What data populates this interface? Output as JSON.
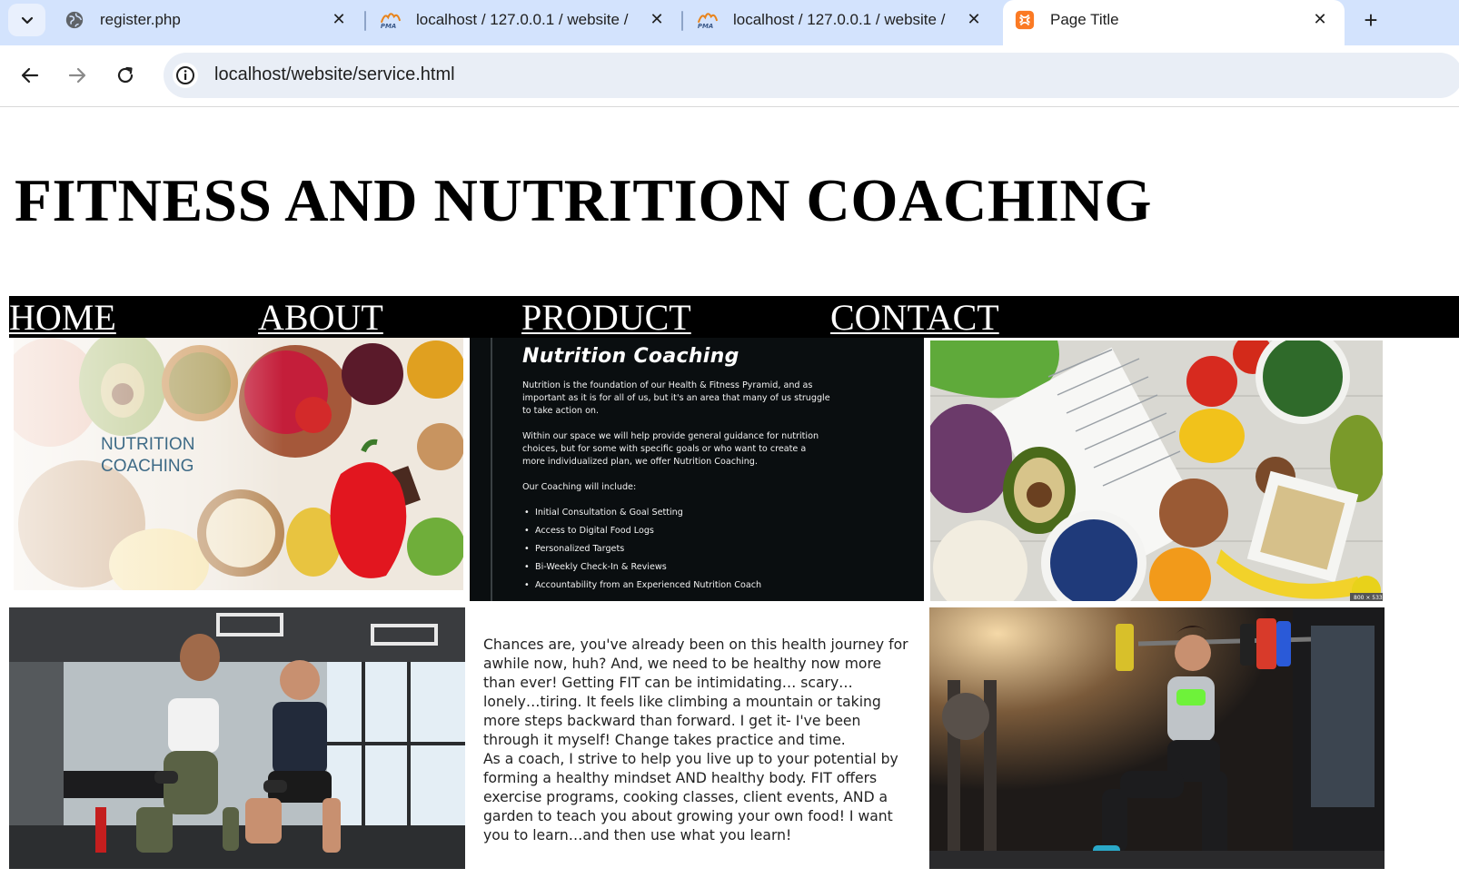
{
  "browser": {
    "tabs": [
      {
        "title": "register.php",
        "favicon": "globe-icon"
      },
      {
        "title": "localhost / 127.0.0.1 / website /",
        "favicon": "phpmyadmin-icon"
      },
      {
        "title": "localhost / 127.0.0.1 / website /",
        "favicon": "phpmyadmin-icon"
      },
      {
        "title": "Page Title",
        "favicon": "xampp-icon",
        "active": true
      }
    ],
    "url": "localhost/website/service.html",
    "colors": {
      "tabstrip": "#d3e3fd",
      "omnibox": "#e9eef6"
    }
  },
  "page": {
    "title": "FITNESS AND NUTRITION COACHING",
    "nav": [
      "HOME",
      "ABOUT",
      "PRODUCT",
      "CONTACT"
    ],
    "colors": {
      "navbar": "#000000",
      "nav_text": "#ffffff"
    },
    "gallery": {
      "nutrition_banner_text": [
        "NUTRITION",
        "COACHING"
      ],
      "info_card": {
        "heading": "Nutrition Coaching",
        "paragraphs": [
          "Nutrition is the foundation of our Health & Fitness Pyramid, and as important as it is for all of us, but it's an area that many of us struggle to take action on.",
          "Within our space we will help provide general guidance for nutrition choices, but for some with specific goals or who want to create a more individualized plan, we offer Nutrition Coaching.",
          "Our Coaching will include:"
        ],
        "items": [
          "Initial Consultation & Goal Setting",
          "Access to Digital Food Logs",
          "Personalized Targets",
          "Bi-Weekly Check-In & Reviews",
          "Accountability from an Experienced Nutrition Coach"
        ]
      },
      "image_badge": "800 × 533"
    },
    "body_paragraphs": [
      "Chances are, you've already been on this health journey for awhile now, huh?  And, we need to be healthy now more than ever!  Getting FIT can be intimidating… scary… lonely…tiring.  It feels like climbing a mountain or taking more steps backward than forward.  I get it- I've been through it myself!  Change takes practice and time.",
      "As a coach, I strive to help you live up to your potential by forming a healthy mindset AND healthy body.  FIT offers exercise programs, cooking classes, client events, AND a garden to teach you about growing your own food!  I want you to learn…and then use what you learn!"
    ]
  }
}
